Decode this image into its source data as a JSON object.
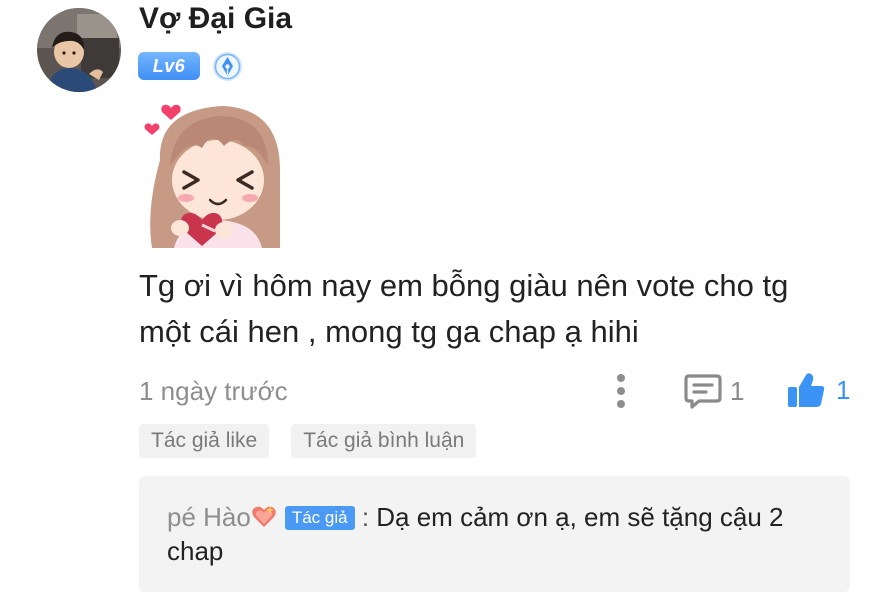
{
  "comment": {
    "username": "Vợ Đại Gia",
    "level": "Lv6",
    "avatar_icon": "user-avatar-photo",
    "medal_icon": "pen-nib-medal-icon",
    "sticker": "anime-girl-holding-heart-sticker",
    "text": "Tg ơi vì hôm nay em bỗng giàu nên vote cho tg một cái hen , mong tg ga chap ạ hihi",
    "timestamp": "1 ngày trước",
    "reply_count": "1",
    "like_count": "1"
  },
  "author_actions": {
    "liked_label": "Tác giả like",
    "replied_label": "Tác giả bình luận"
  },
  "reply": {
    "username": "pé Hào",
    "emoji": "sparkling-heart-icon",
    "author_badge": "Tác giả",
    "separator": " : ",
    "text": "Dạ em cảm ơn ạ, em sẽ tặng cậu 2 chap"
  },
  "colors": {
    "accent_blue": "#3b93f5",
    "level_badge": "#4a9af5",
    "muted_text": "#8e8e8e",
    "reply_bg": "#f3f3f3"
  }
}
